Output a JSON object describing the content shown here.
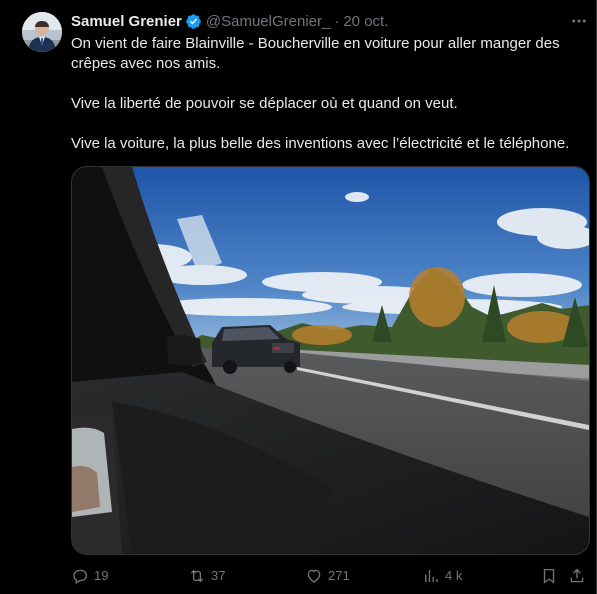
{
  "tweet": {
    "author_name": "Samuel Grenier",
    "handle": "@SamuelGrenier_",
    "separator": "·",
    "date": "20 oct.",
    "paragraphs": [
      "On vient de faire Blainville - Boucherville en voiture pour aller manger des crêpes avec nos amis.",
      "Vive la liberté de pouvoir se déplacer où et quand on veut.",
      "Vive la voiture, la plus belle des inventions avec l’électricité et le téléphone."
    ],
    "stats": {
      "replies": "19",
      "reposts": "37",
      "likes": "271",
      "views": "4 k"
    }
  },
  "colors": {
    "background": "#000000",
    "text": "#e7e9ea",
    "muted": "#71767b",
    "verified": "#1d9bf0",
    "border": "#2f3336"
  },
  "icons": [
    "verified-badge-icon",
    "more-icon",
    "reply-icon",
    "repost-icon",
    "like-icon",
    "views-icon",
    "bookmark-icon",
    "share-icon"
  ]
}
